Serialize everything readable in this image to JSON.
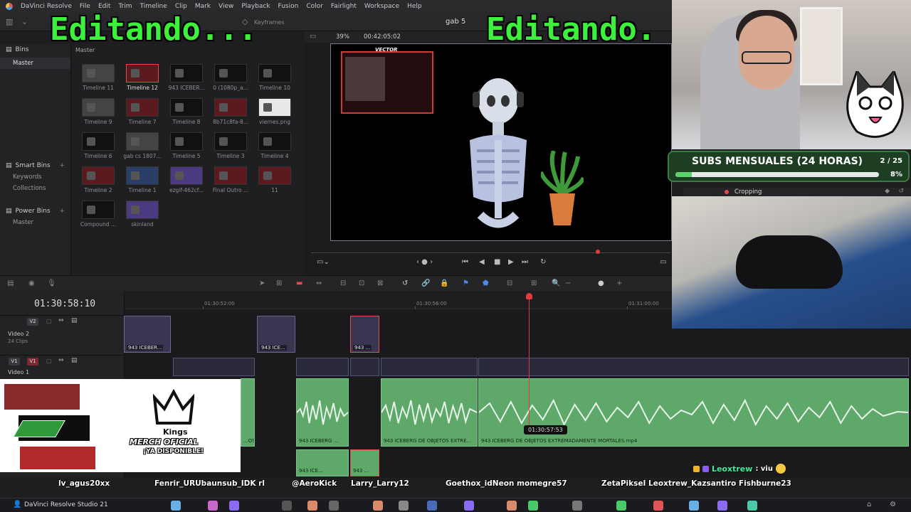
{
  "menu": {
    "app_name": "DaVinci Resolve",
    "items": [
      "File",
      "Edit",
      "Trim",
      "Timeline",
      "Clip",
      "Mark",
      "View",
      "Playback",
      "Fusion",
      "Color",
      "Fairlight",
      "Workspace",
      "Help"
    ]
  },
  "toolbar": {
    "timeline_name": "gab 5",
    "keyframes_label": "Keyframes"
  },
  "left_panel": {
    "bins_label": "Bins",
    "master_label": "Master",
    "smart_bins_label": "Smart Bins",
    "keywords_label": "Keywords",
    "collections_label": "Collections",
    "power_bins_label": "Power Bins",
    "power_master_label": "Master"
  },
  "media_pool": {
    "title": "Master",
    "clips": [
      {
        "label": "Timeline 11",
        "kind": "gray"
      },
      {
        "label": "Timeline 12",
        "kind": "sel"
      },
      {
        "label": "943 ICEBER...",
        "kind": "dark"
      },
      {
        "label": "0 (1080p_a...",
        "kind": "dark"
      },
      {
        "label": "Timeline 10",
        "kind": "dark"
      },
      {
        "label": "Timeline 9",
        "kind": "gray"
      },
      {
        "label": "Timeline 7",
        "kind": "red"
      },
      {
        "label": "Timeline 8",
        "kind": "dark"
      },
      {
        "label": "8b71c8fa-8...",
        "kind": "red"
      },
      {
        "label": "viernes.png",
        "kind": "white"
      },
      {
        "label": "Timeline 6",
        "kind": "dark"
      },
      {
        "label": "gab cs 1807...",
        "kind": "gray"
      },
      {
        "label": "Timeline 5",
        "kind": "dark"
      },
      {
        "label": "Timeline 3",
        "kind": "dark"
      },
      {
        "label": "Timeline 4",
        "kind": "dark"
      },
      {
        "label": "Timeline 2",
        "kind": "red"
      },
      {
        "label": "Timeline 1",
        "kind": "blue"
      },
      {
        "label": "ezgif-462cf...",
        "kind": "purple"
      },
      {
        "label": "Final Outro ...",
        "kind": "red"
      },
      {
        "label": "11",
        "kind": "red"
      },
      {
        "label": "Compound ...",
        "kind": "dark"
      },
      {
        "label": "skinland",
        "kind": "purple"
      }
    ]
  },
  "viewer": {
    "zoom": "39%",
    "timecode": "00:42:05:02",
    "stream_card_text": "VECTOR"
  },
  "timeline": {
    "current_timecode": "01:30:58:10",
    "ruler_ticks": [
      "01:30:52:00",
      "01:30:56:00",
      "01:31:00:00"
    ],
    "tracks": {
      "v2_badge": "V2",
      "v2_name": "Video 2",
      "v2_sub": "24 Clips",
      "v1_badge_a": "V1",
      "v1_badge_b": "V1",
      "v1_name": "Video 1"
    },
    "v2_clip_label": "943 ICEBER...",
    "v2_clip_label_short": "943 ICE...",
    "v2_clip_label_tiny": "943 ...",
    "audio_clip_label_a": "943 ICEBERG ...",
    "audio_clip_label_b": "943 ICEBERG DE OBJETOS EXTRE...",
    "audio_clip_label_c": "943 ICEBERG DE OBJETOS EXTREMADAMENTE MORTALES.mp4",
    "audio_clip_label_d": "...OS",
    "a2_label": "943 ICE...",
    "a2_label_tiny": "943 ...",
    "hover_timecode": "01:30:57:53"
  },
  "overlay": {
    "editando_left": "Editando...",
    "editando_right": "Editando.",
    "subs_title": "SUBS MENSUALES (24 HORAS)",
    "subs_count": "2 / 25",
    "subs_percent_label": "8%",
    "subs_fraction": 0.08,
    "cropping_label": "Cropping",
    "merch_brand": "Kings",
    "merch_title": "MERCH OFICIAL",
    "merch_subtitle": "¡YA DISPONIBLE!",
    "chat_user": "Leoxtrew",
    "chat_text": ": viu",
    "ticker": [
      "lv_agus20xx",
      "Fenrir_URUbaunsub_IDK rl",
      "@AeroKick",
      "Larry_Larry12",
      "Goethox_idNeon momegre57",
      "ZetaPikseI Leoxtrew_Kazsantiro Fishburne23"
    ]
  },
  "taskbar": {
    "app_label": "DaVinci Resolve Studio 21"
  },
  "colors": {
    "accent_green": "#3cf03c",
    "audio_green": "#5ea86a",
    "playhead_red": "#e23a3a"
  }
}
